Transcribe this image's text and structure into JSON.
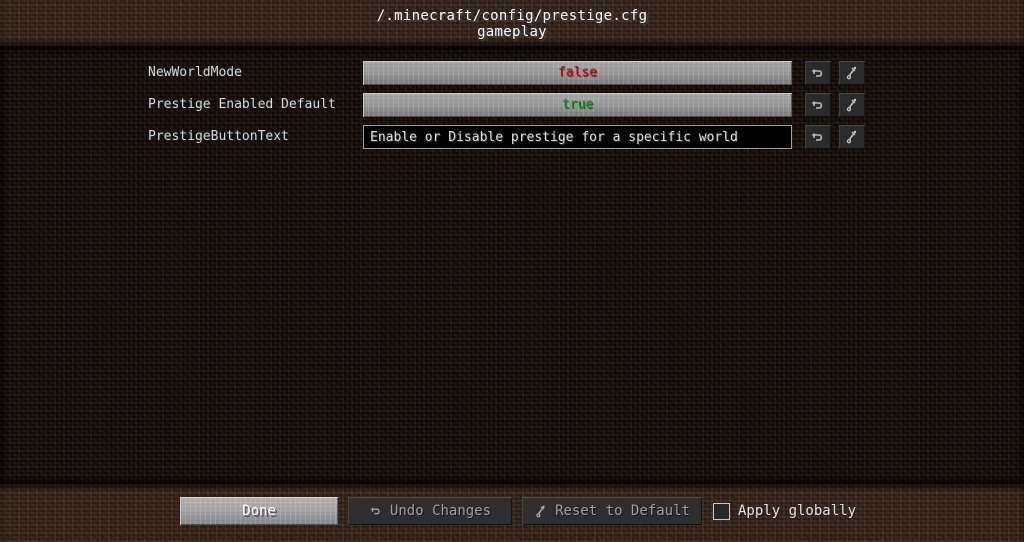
{
  "header": {
    "title": "/.minecraft/config/prestige.cfg",
    "subtitle": "gameplay"
  },
  "options": [
    {
      "label": "NewWorldMode",
      "type": "boolean",
      "value": "false",
      "value_color": "#d00000",
      "undo_icon": "undo-arrow-icon",
      "reset_icon": "reset-default-icon"
    },
    {
      "label": "Prestige Enabled Default",
      "type": "boolean",
      "value": "true",
      "value_color": "#00a000",
      "undo_icon": "undo-arrow-icon",
      "reset_icon": "reset-default-icon"
    },
    {
      "label": "PrestigeButtonText",
      "type": "text",
      "value": "Enable or Disable prestige for a specific world",
      "undo_icon": "undo-arrow-icon",
      "reset_icon": "reset-default-icon"
    }
  ],
  "footer": {
    "done_label": "Done",
    "undo_label": "Undo Changes",
    "reset_label": "Reset to Default",
    "apply_globally_label": "Apply globally",
    "apply_globally_checked": false
  },
  "colors": {
    "dirt_bright": "#312117",
    "dirt_dark": "#140d08",
    "button_gray": "#9c9c9c",
    "button_dark": "#2e2e2e",
    "text_light": "#d8d8d8",
    "text_disabled": "#a0a0a0",
    "value_false": "#d00000",
    "value_true": "#00a000"
  }
}
